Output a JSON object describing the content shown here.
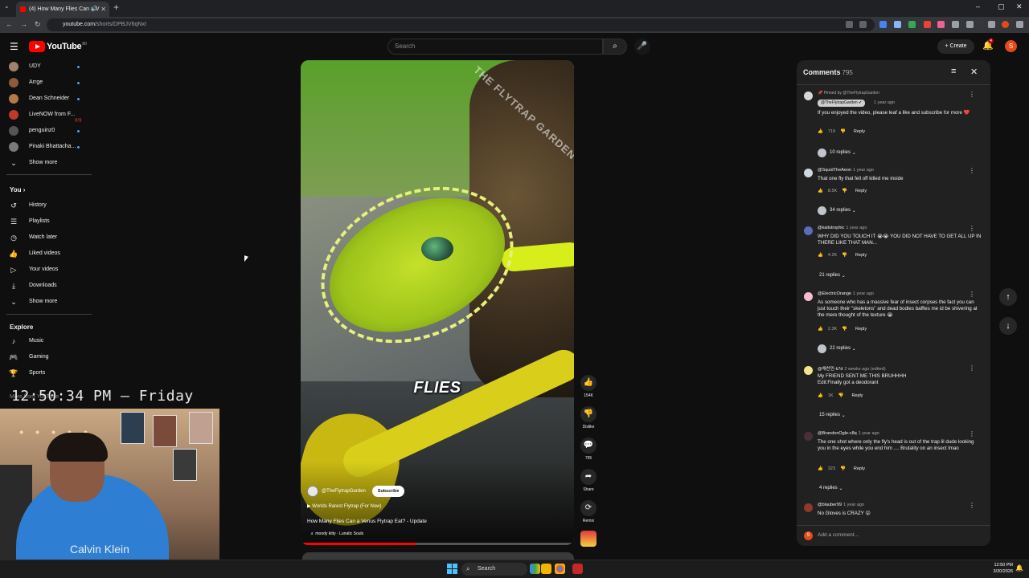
{
  "browser": {
    "tab_title": "(4) How Many Flies Can a V",
    "new_tab": "+",
    "url_host": "youtube.com",
    "url_path": "/shorts/DPBJV6qNxI",
    "window_controls": [
      "–",
      "▢",
      "✕"
    ]
  },
  "header": {
    "logo_text": "YouTube",
    "logo_country": "80",
    "search_placeholder": "Search",
    "create_label": "+ Create",
    "notif_count": "4",
    "me_initial": "S"
  },
  "sidebar": {
    "subscriptions": [
      {
        "label": "UDY",
        "color": "#a08070",
        "indicator": "dot"
      },
      {
        "label": "Arrge",
        "color": "#8c5a3c",
        "indicator": "dot"
      },
      {
        "label": "Dean Schneider",
        "color": "#b07a4a",
        "indicator": "dot"
      },
      {
        "label": "LiveNOW from F...",
        "color": "#c0392b",
        "indicator": "live"
      },
      {
        "label": "penguinz0",
        "color": "#555555",
        "indicator": "dot"
      },
      {
        "label": "Pinaki Bhattacha...",
        "color": "#7a7a7a",
        "indicator": "dot"
      }
    ],
    "show_more_1": "Show more",
    "you_heading": "You",
    "you_items": [
      {
        "label": "History",
        "icon": "history-icon",
        "glyph": "↺"
      },
      {
        "label": "Playlists",
        "icon": "playlists-icon",
        "glyph": "☰"
      },
      {
        "label": "Watch later",
        "icon": "clock-icon",
        "glyph": "◷"
      },
      {
        "label": "Liked videos",
        "icon": "thumb-up-icon",
        "glyph": "👍"
      },
      {
        "label": "Your videos",
        "icon": "play-icon",
        "glyph": "▷"
      },
      {
        "label": "Downloads",
        "icon": "download-icon",
        "glyph": "⤓"
      }
    ],
    "show_more_2": "Show more",
    "explore_heading": "Explore",
    "explore_items": [
      {
        "label": "Music",
        "icon": "music-icon",
        "glyph": "♪"
      },
      {
        "label": "Gaming",
        "icon": "gaming-icon",
        "glyph": "🎮"
      },
      {
        "label": "Sports",
        "icon": "trophy-icon",
        "glyph": "🏆"
      }
    ],
    "more_from_youtube": "More from YouTube"
  },
  "overlay": {
    "clock": "12:50:34 PM — Friday",
    "shirt_brand": "Calvin Klein"
  },
  "short": {
    "watermark": "THE FLYTRAP GARDEN",
    "caption": "FLIES",
    "channel": "@TheFlytrapGarden",
    "subscribe": "Subscribe",
    "related": "▶  Worlds Rarest Flytrap (For Now)",
    "title": "How Many Flies Can a Venus Flytrap Eat? - Update",
    "music": "♬ moody kitty · Lunatic Souls",
    "progress_fraction": 0.42
  },
  "actions": {
    "like_count": "154K",
    "dislike_label": "Dislike",
    "comment_count": "795",
    "share_label": "Share",
    "remix_label": "Remix"
  },
  "comments": {
    "heading": "Comments",
    "count": "795",
    "add_placeholder": "Add a comment...",
    "items": [
      {
        "pinned": "Pinned by @TheFlytrapGarden",
        "user": "@TheFlytrapGarden",
        "when": "1 year ago",
        "text": "If you enjoyed the video, please leaf a like and subscribe for more ❤️",
        "likes": "719",
        "replies": "10 replies",
        "avatar": "#d8d8d8"
      },
      {
        "user": "@SquidTheAeon",
        "when": "1 year ago",
        "text": "That one fly that fell off killed me inside",
        "likes": "8.5K",
        "replies": "34 replies",
        "avatar": "#cfd8dc"
      },
      {
        "user": "@kaitstrophic",
        "when": "1 year ago",
        "text": "WHY DID YOU TOUCH IT 😭😭 YOU DID NOT HAVE TO GET ALL UP IN THERE LIKE THAT MAN...",
        "likes": "4.2K",
        "replies": "21 replies",
        "avatar": "#5c6bc0"
      },
      {
        "user": "@ElectricOrange",
        "when": "1 year ago",
        "text": "As someone who has a massive fear of insect corpses the fact you can just touch their \"skeletons\" and dead bodies baffles me id be shivering at the mere thought of the texture 😭",
        "likes": "2.3K",
        "replies": "22 replies",
        "avatar": "#f8bbd0"
      },
      {
        "user": "@채찬민-k7d",
        "when": "2 weeks ago (edited)",
        "text": "My FRIEND SENT ME THIS BRUHHHH Edit:Finally got a deodorant",
        "likes": "1K",
        "replies": "15 replies",
        "avatar": "#f0e68c"
      },
      {
        "user": "@BrandonOgle-c8q",
        "when": "1 year ago",
        "text": "The one shot where only the fly's head is out of the trap lil dude looking you in the eyes while you end him .... Brutality on an insect lmao",
        "likes": "323",
        "replies": "4 replies",
        "avatar": "#4a3036"
      },
      {
        "user": "@blauber99",
        "when": "1 year ago",
        "text": "No Gloves is CRAZY 😮",
        "likes": "",
        "replies": "",
        "avatar": "#8d3a2a"
      }
    ],
    "reply_label": "Reply"
  },
  "taskbar": {
    "search": "Search",
    "time": "12:50 PM",
    "date": "3/20/2026"
  }
}
